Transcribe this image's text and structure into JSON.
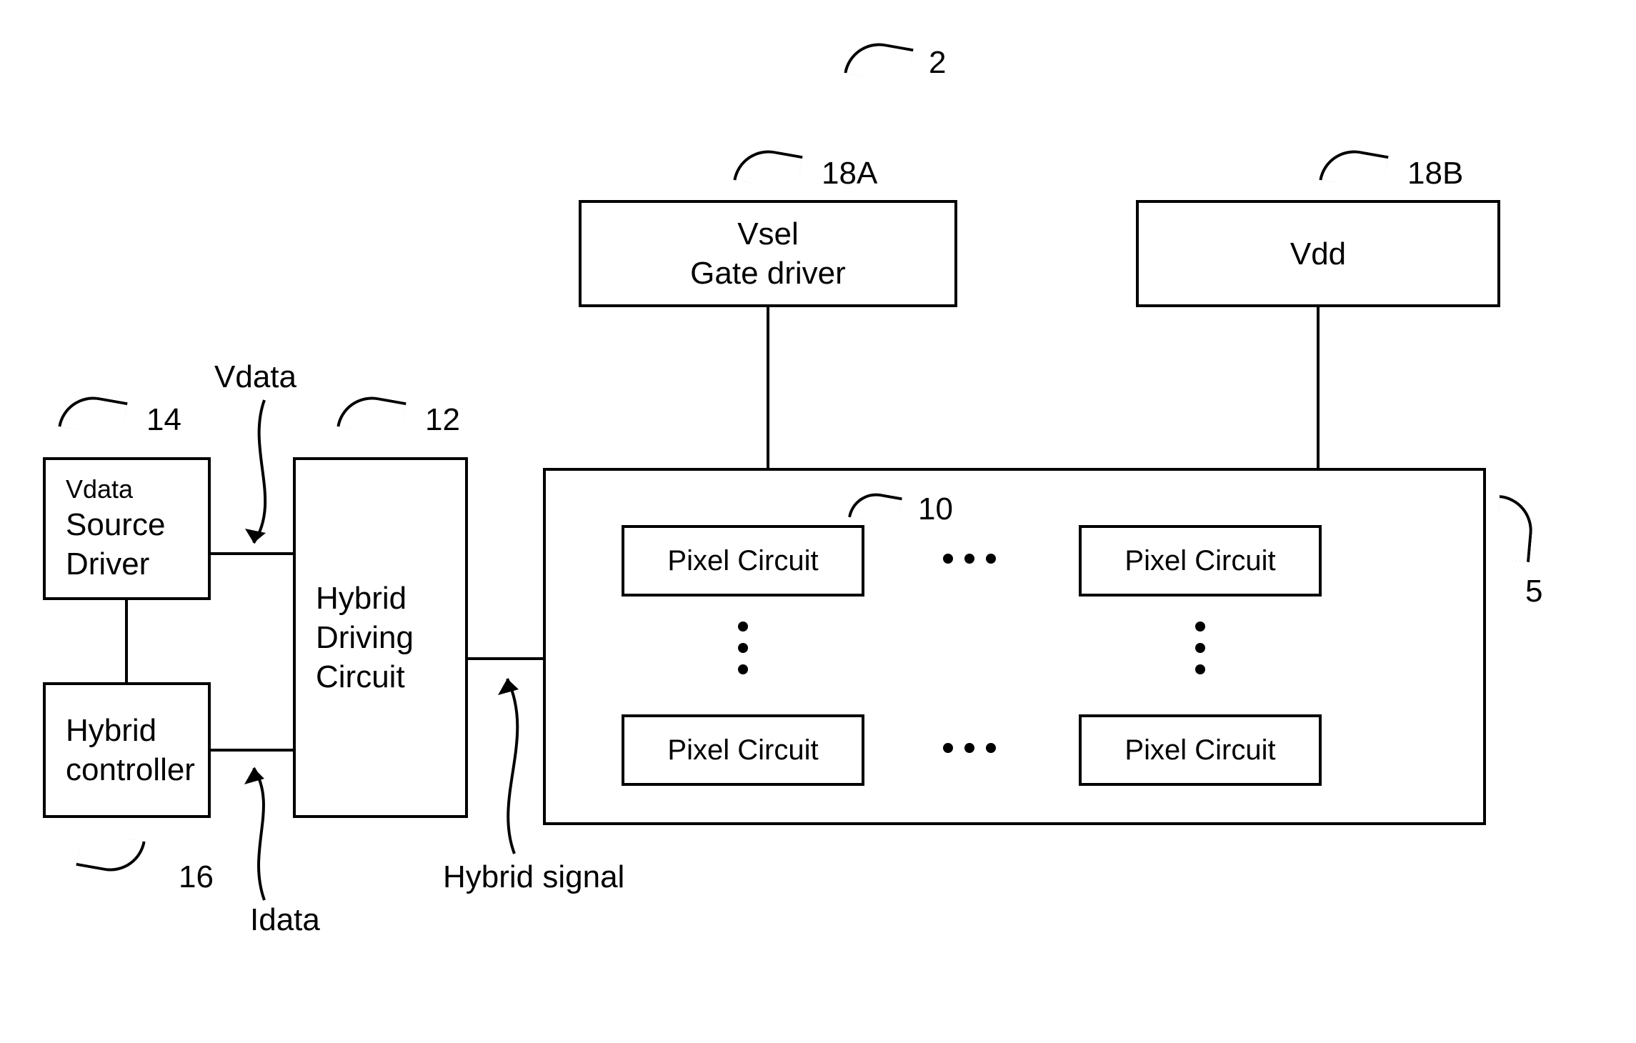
{
  "refs": {
    "system": "2",
    "pixel_array": "5",
    "pixel_circuit": "10",
    "hybrid_driving": "12",
    "source_driver": "14",
    "hybrid_controller": "16",
    "gate_driver": "18A",
    "vdd": "18B"
  },
  "blocks": {
    "source_driver_small": "Vdata",
    "source_driver_l1": "Source",
    "source_driver_l2": "Driver",
    "hybrid_controller_l1": "Hybrid",
    "hybrid_controller_l2": "controller",
    "hybrid_driving_l1": "Hybrid",
    "hybrid_driving_l2": "Driving",
    "hybrid_driving_l3": "Circuit",
    "gate_driver_l1": "Vsel",
    "gate_driver_l2": "Gate driver",
    "vdd_l1": "Vdd",
    "pixel_circuit": "Pixel Circuit"
  },
  "signals": {
    "vdata": "Vdata",
    "idata": "Idata",
    "hybrid_signal": "Hybrid signal"
  }
}
